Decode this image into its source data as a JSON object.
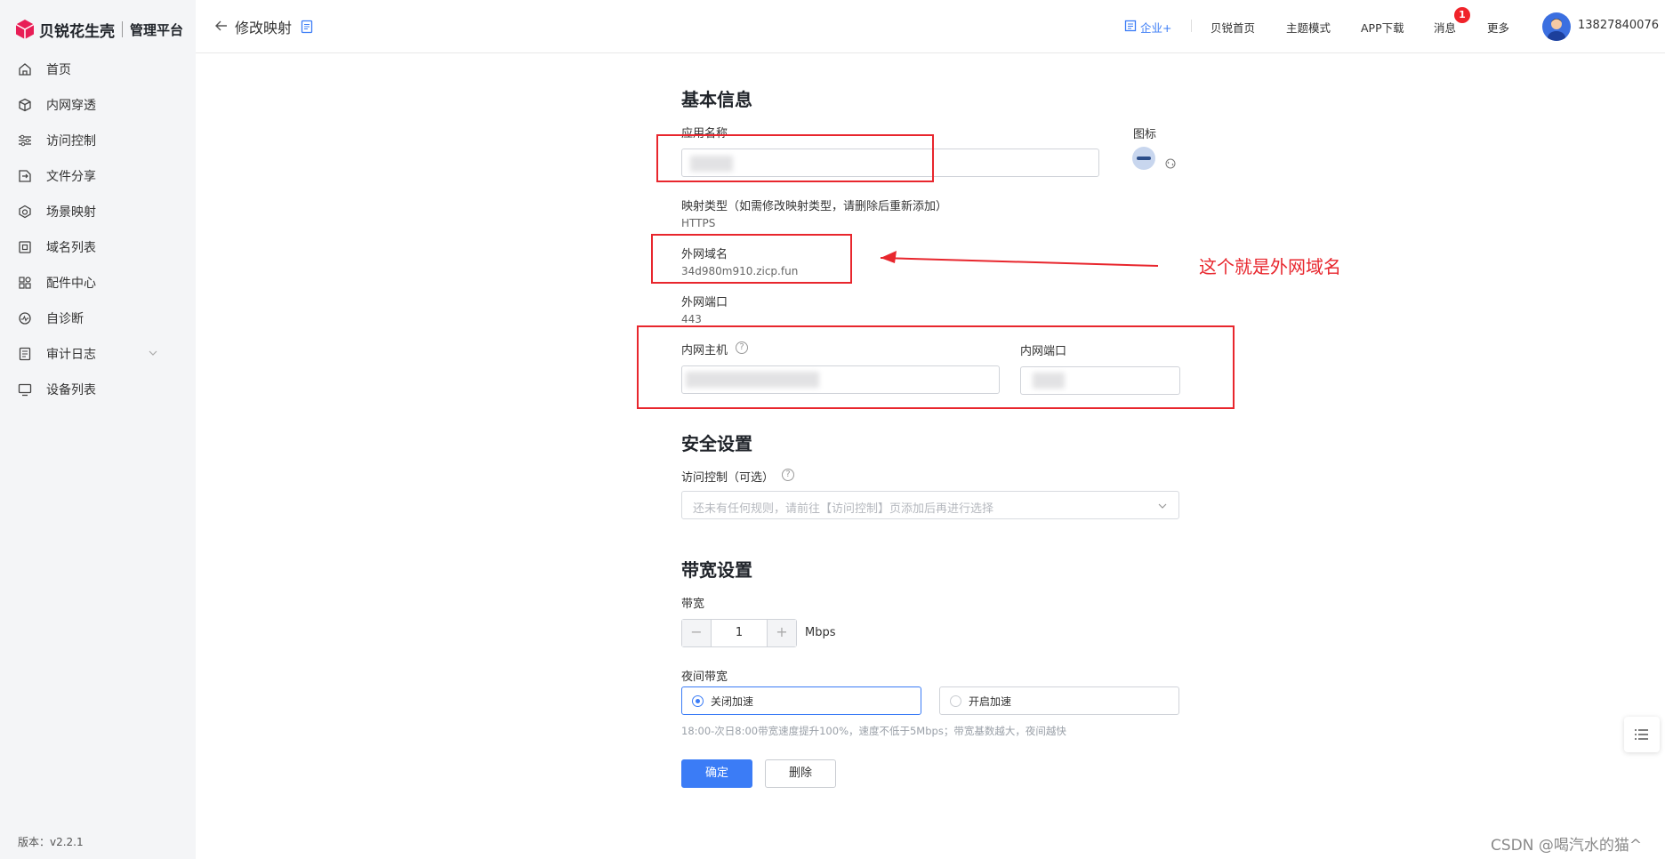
{
  "brand": {
    "name": "贝锐花生壳",
    "subtitle": "管理平台"
  },
  "sidebar": {
    "items": [
      {
        "label": "首页",
        "icon": "home-icon"
      },
      {
        "label": "内网穿透",
        "icon": "cube-icon"
      },
      {
        "label": "访问控制",
        "icon": "sliders-icon"
      },
      {
        "label": "文件分享",
        "icon": "folder-share-icon"
      },
      {
        "label": "场景映射",
        "icon": "scene-icon"
      },
      {
        "label": "域名列表",
        "icon": "domain-icon"
      },
      {
        "label": "配件中心",
        "icon": "grid-icon"
      },
      {
        "label": "自诊断",
        "icon": "diagnose-icon"
      },
      {
        "label": "审计日志",
        "icon": "log-icon"
      },
      {
        "label": "设备列表",
        "icon": "monitor-icon"
      }
    ],
    "version": "版本：v2.2.1"
  },
  "header": {
    "title": "修改映射",
    "links": {
      "enterprise": "企业+",
      "home": "贝锐首页",
      "theme": "主题模式",
      "app": "APP下载",
      "messages": "消息",
      "more": "更多"
    },
    "message_badge": "1",
    "phone": "13827840076"
  },
  "form": {
    "basic_title": "基本信息",
    "app_name_label": "应用名称",
    "icon_label": "图标",
    "mapping_type_label": "映射类型（如需修改映射类型，请删除后重新添加）",
    "mapping_type_value": "HTTPS",
    "domain_label": "外网域名",
    "domain_value": "34d980m910.zicp.fun",
    "ext_port_label": "外网端口",
    "ext_port_value": "443",
    "host_label": "内网主机",
    "int_port_label": "内网端口",
    "security_title": "安全设置",
    "access_label": "访问控制（可选）",
    "access_placeholder": "还未有任何规则，请前往【访问控制】页添加后再进行选择",
    "bandwidth_title": "带宽设置",
    "bandwidth_label": "带宽",
    "bandwidth_value": "1",
    "bandwidth_unit": "Mbps",
    "night_label": "夜间带宽",
    "night_options": [
      "关闭加速",
      "开启加速"
    ],
    "night_selected": "关闭加速",
    "night_hint": "18:00-次日8:00带宽速度提升100%，速度不低于5Mbps；带宽基数越大，夜间越快",
    "confirm": "确定",
    "delete": "删除"
  },
  "annotation": {
    "text": "这个就是外网域名"
  },
  "watermark": "CSDN @喝汽水的猫^",
  "colors": {
    "accent": "#3b7cf6",
    "annotation": "#e8262d",
    "badge": "#f0232a",
    "brand": "#e81e56"
  }
}
